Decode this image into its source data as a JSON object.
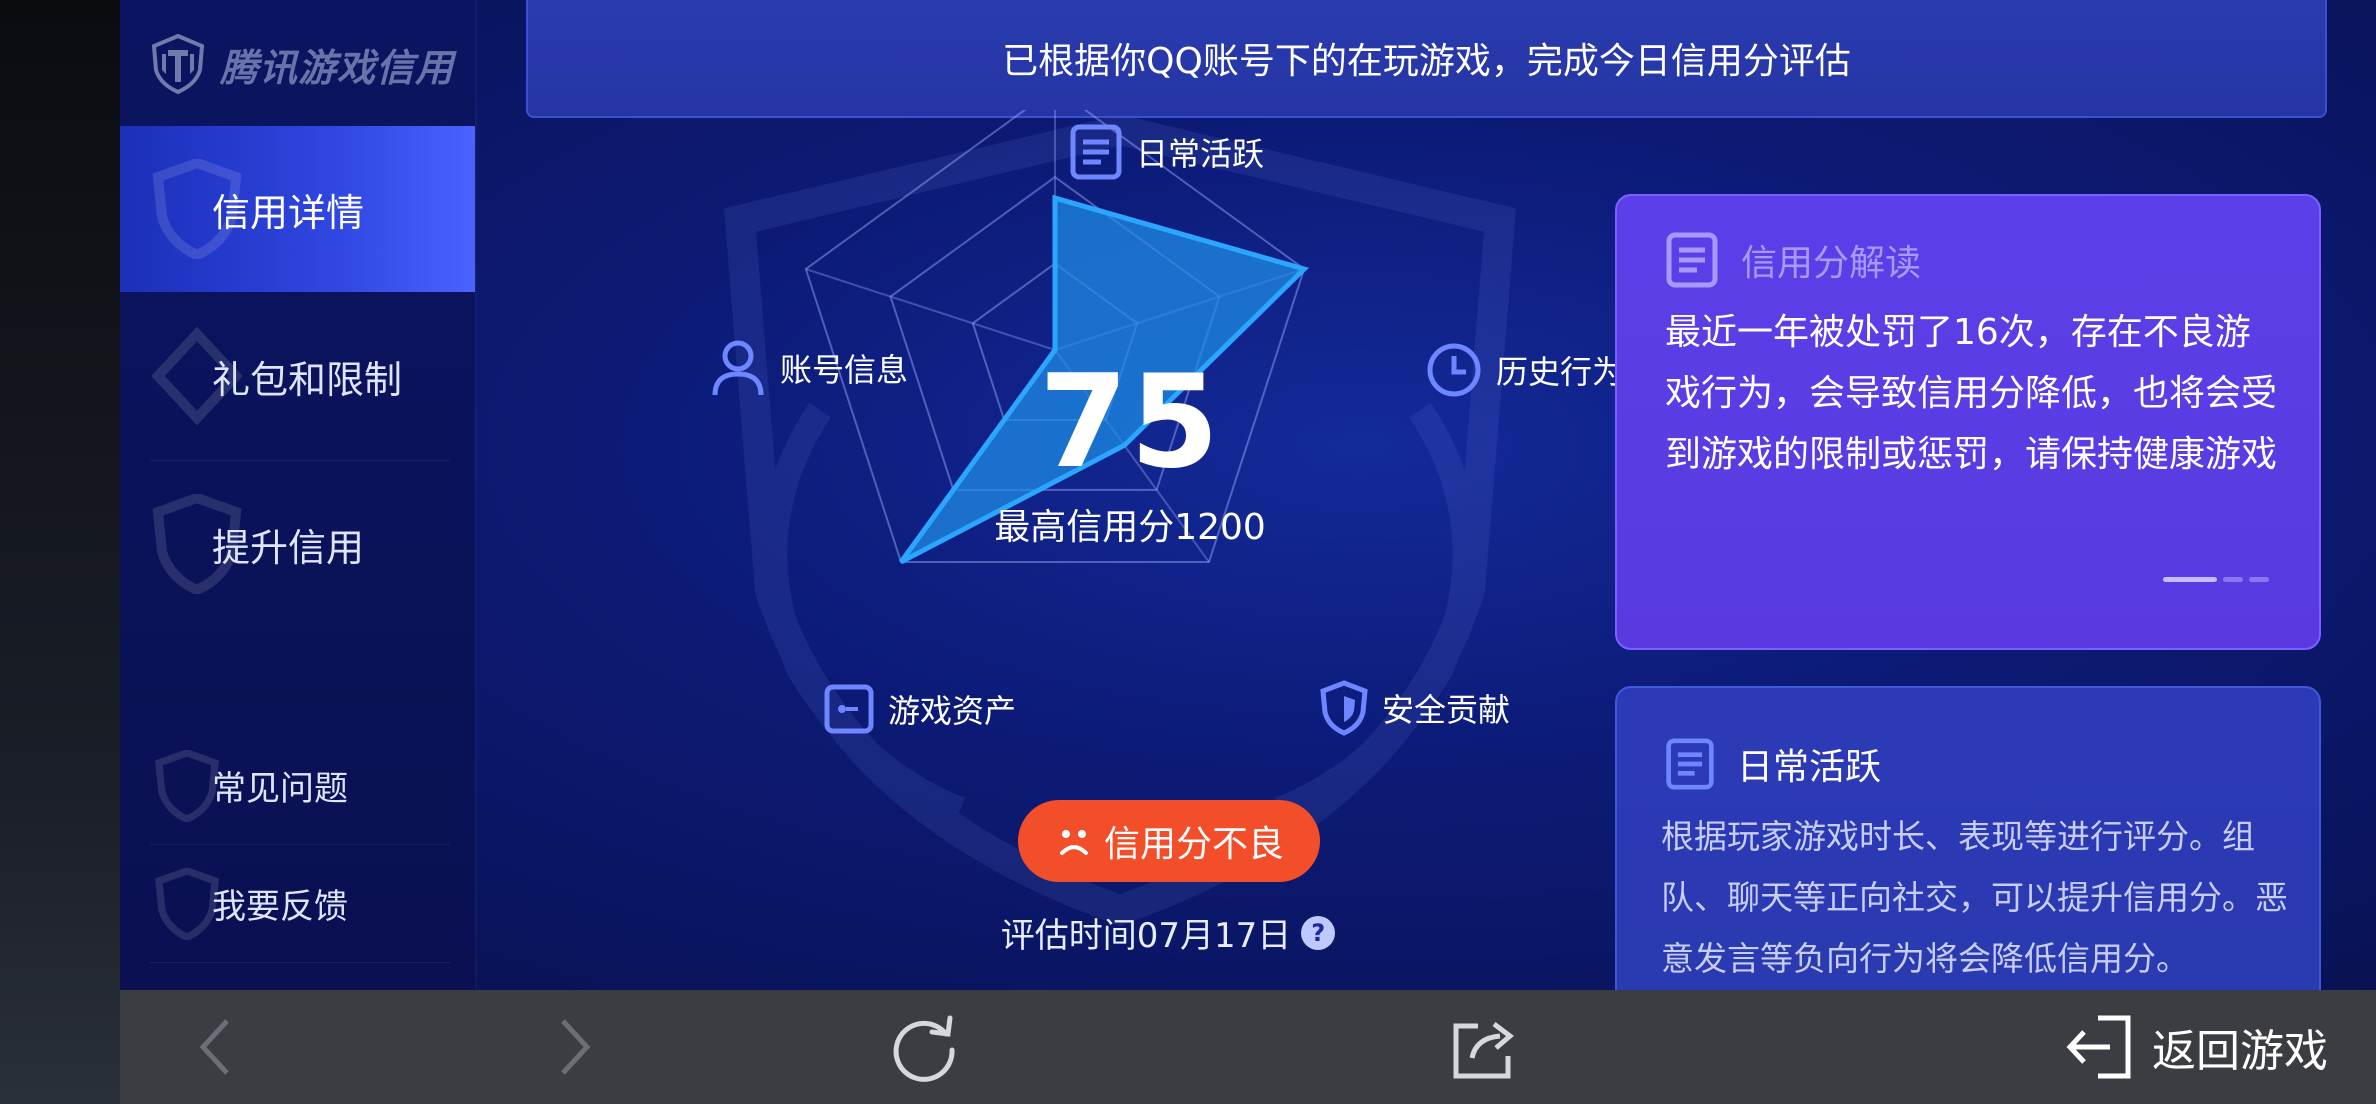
{
  "brand": {
    "name": "腾讯游戏信用"
  },
  "sidebar": {
    "items": [
      {
        "label": "信用详情",
        "active": true
      },
      {
        "label": "礼包和限制",
        "active": false
      },
      {
        "label": "提升信用",
        "active": false
      },
      {
        "label": "常见问题",
        "active": false
      },
      {
        "label": "我要反馈",
        "active": false
      }
    ]
  },
  "notice": {
    "text": "已根据你QQ账号下的在玩游戏，完成今日信用分评估"
  },
  "radar": {
    "axes": [
      {
        "label": "日常活跃",
        "icon": "document-icon",
        "value": 0.58
      },
      {
        "label": "历史行为",
        "icon": "clock-icon",
        "value": 1.0
      },
      {
        "label": "安全贡献",
        "icon": "shield-icon",
        "value": 0.45
      },
      {
        "label": "游戏资产",
        "icon": "key-card-icon",
        "value": 1.0
      },
      {
        "label": "账号信息",
        "icon": "user-icon",
        "value": 0.0
      }
    ],
    "score": "75",
    "max_label": "最高信用分1200"
  },
  "status": {
    "label": "信用分不良",
    "color": "#f24e2a"
  },
  "eval_time": {
    "label": "评估时间07月17日",
    "help": "?"
  },
  "interpretation_card": {
    "title": "信用分解读",
    "body": "最近一年被处罚了16次，存在不良游戏行为，会导致信用分降低，也将会受到游戏的限制或惩罚，请保持健康游戏"
  },
  "daily_card": {
    "title": "日常活跃",
    "body": "根据玩家游戏时长、表现等进行评分。组队、聊天等正向社交，可以提升信用分。恶意发言等负向行为将会降低信用分。"
  },
  "bottom_bar": {
    "back_label": "返回游戏"
  },
  "colors": {
    "accent": "#2f46e0",
    "radar_fill": "#1e8fe6",
    "card_purple": "#5b3fe8"
  }
}
